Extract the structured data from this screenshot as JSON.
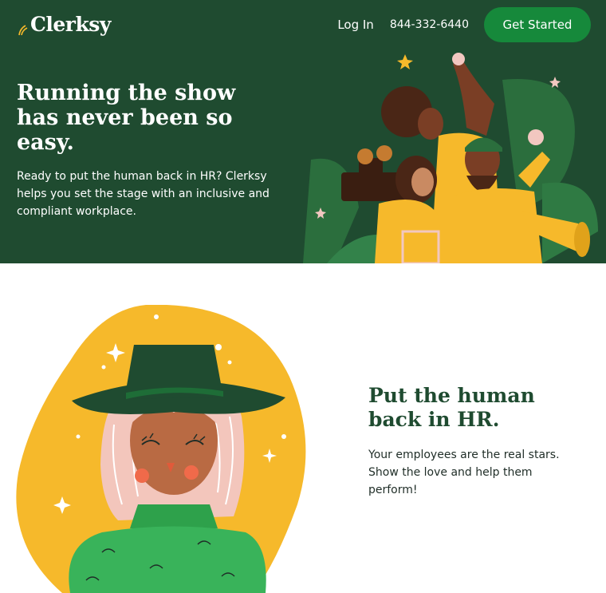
{
  "brand": {
    "name": "Clerksy",
    "accent": "#16893b",
    "dark_green": "#1f4b30",
    "yellow": "#f6b92b"
  },
  "nav": {
    "login": "Log In",
    "phone": "844-332-6440",
    "cta": "Get Started"
  },
  "hero": {
    "title": "Running the show has never been so easy.",
    "text": "Ready to put the human back in HR? Clerksy helps you set the stage with an inclusive and compliant workplace."
  },
  "section": {
    "heading": "Put the human back in HR.",
    "text": "Your employees are the real stars. Show the love and help them perform!"
  }
}
